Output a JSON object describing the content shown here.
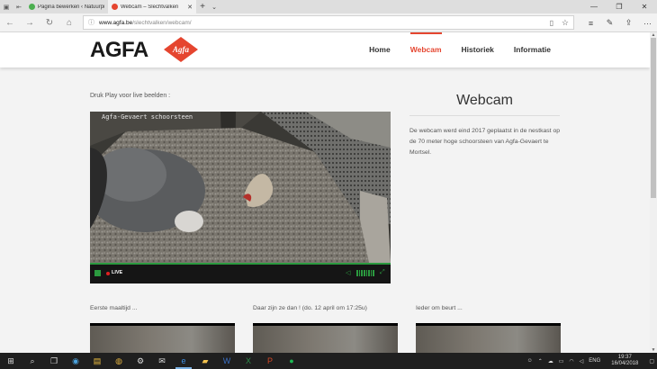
{
  "browser": {
    "tabs": [
      {
        "title": "Pagina bewerken ‹ Natuurpunt",
        "active": false,
        "icon_color": "#4caf50"
      },
      {
        "title": "Webcam – Slechtvalken",
        "active": true,
        "icon_color": "#e5452f"
      }
    ],
    "address": {
      "host": "www.agfa.be",
      "path": "/slechtvalken/webcam/"
    }
  },
  "site": {
    "logo_text": "AGFA",
    "logo_badge": "Agfa",
    "brand_color": "#e5452f",
    "nav": [
      {
        "label": "Home",
        "active": false
      },
      {
        "label": "Webcam",
        "active": true
      },
      {
        "label": "Historiek",
        "active": false
      },
      {
        "label": "Informatie",
        "active": false
      }
    ]
  },
  "main": {
    "intro": "Druk Play voor live beelden :",
    "player": {
      "overlay_text": "Agfa-Gevaert schoorsteen",
      "live_label": "LIVE"
    },
    "sidebar": {
      "title": "Webcam",
      "text": "De webcam werd eind 2017 geplaatst in de nestkast op de 70 meter hoge schoorsteen van Agfa-Gevaert te Mortsel."
    },
    "thumbnails": [
      {
        "title": "Eerste maaltijd ..."
      },
      {
        "title": "Daar zijn ze dan ! (do. 12 april om 17:25u)"
      },
      {
        "title": "Ieder om beurt ..."
      }
    ]
  },
  "taskbar": {
    "language": "ENG",
    "time": "19:37",
    "date": "16/04/2018"
  }
}
